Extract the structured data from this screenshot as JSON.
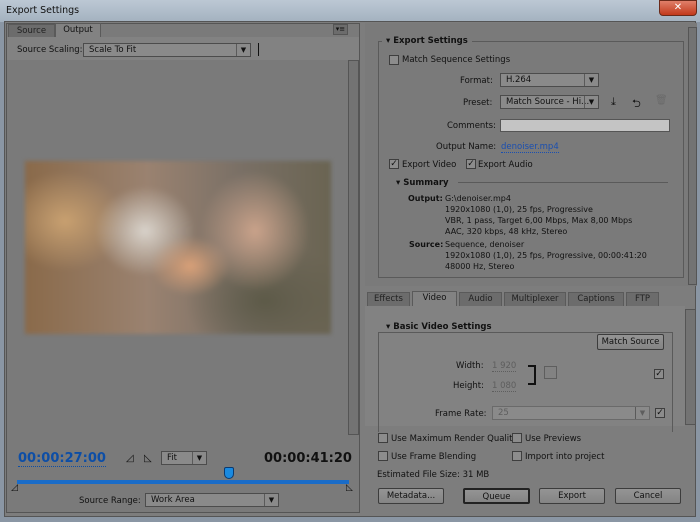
{
  "window": {
    "title": "Export Settings",
    "close_glyph": "✕"
  },
  "left": {
    "tabs": [
      {
        "label": "Source"
      },
      {
        "label": "Output"
      }
    ],
    "panel_menu_icon": "panel-menu-icon",
    "source_scaling_label": "Source Scaling:",
    "source_scaling_value": "Scale To Fit",
    "current_time": "00:00:27:00",
    "duration": "00:00:41:20",
    "zoom_value": "Fit",
    "playhead_fraction": 0.64,
    "source_range_label": "Source Range:",
    "source_range_value": "Work Area"
  },
  "export_settings": {
    "heading": "Export Settings",
    "match_sequence": {
      "label": "Match Sequence Settings",
      "checked": false
    },
    "format_label": "Format:",
    "format_value": "H.264",
    "preset_label": "Preset:",
    "preset_value": "Match Source - Hi...",
    "comments_label": "Comments:",
    "comments_value": "",
    "output_name_label": "Output Name:",
    "output_name_value": "denoiser.mp4",
    "export_video": {
      "label": "Export Video",
      "checked": true
    },
    "export_audio": {
      "label": "Export Audio",
      "checked": true
    },
    "summary": {
      "heading": "Summary",
      "output_label": "Output:",
      "output_lines": [
        "G:\\denoiser.mp4",
        "1920x1080 (1,0), 25 fps, Progressive",
        "VBR, 1 pass, Target 6,00 Mbps, Max 8,00 Mbps",
        "AAC, 320 kbps, 48 kHz, Stereo"
      ],
      "source_label": "Source:",
      "source_lines": [
        "Sequence, denoiser",
        "1920x1080 (1,0), 25 fps, Progressive, 00:00:41:20",
        "48000 Hz, Stereo"
      ]
    }
  },
  "settings_tabs": [
    {
      "label": "Effects"
    },
    {
      "label": "Video"
    },
    {
      "label": "Audio"
    },
    {
      "label": "Multiplexer"
    },
    {
      "label": "Captions"
    },
    {
      "label": "FTP"
    }
  ],
  "video": {
    "heading": "Basic Video Settings",
    "match_source_label": "Match Source",
    "width_label": "Width:",
    "width_value": "1 920",
    "height_label": "Height:",
    "height_value": "1 080",
    "frame_rate_label": "Frame Rate:",
    "frame_rate_value": "25"
  },
  "bottom": {
    "max_render": {
      "label": "Use Maximum Render Quality",
      "checked": false
    },
    "use_previews": {
      "label": "Use Previews",
      "checked": false
    },
    "frame_blending": {
      "label": "Use Frame Blending",
      "checked": false
    },
    "import_project": {
      "label": "Import into project",
      "checked": false
    },
    "file_size": "Estimated File Size:  31 MB",
    "buttons": {
      "metadata": "Metadata...",
      "queue": "Queue",
      "export": "Export",
      "cancel": "Cancel"
    }
  },
  "colors": {
    "accent": "#1a5fb4",
    "timecode": "#0d4ea6",
    "playbar": "#1a6cc8"
  }
}
